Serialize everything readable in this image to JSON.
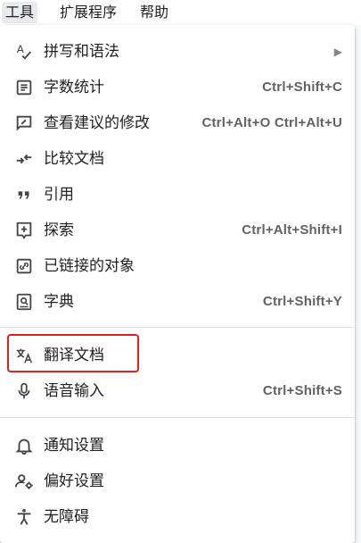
{
  "menubar": {
    "tools": "工具",
    "extensions": "扩展程序",
    "help": "帮助"
  },
  "menu": {
    "spelling": {
      "label": "拼写和语法",
      "icon": "spellcheck-icon"
    },
    "word_count": {
      "label": "字数统计",
      "shortcut": "Ctrl+Shift+C",
      "icon": "word-count-icon"
    },
    "review_edits": {
      "label": "查看建议的修改",
      "shortcut": "Ctrl+Alt+O Ctrl+Alt+U",
      "icon": "rate-review-icon"
    },
    "compare_docs": {
      "label": "比较文档",
      "icon": "compare-icon"
    },
    "citations": {
      "label": "引用",
      "icon": "quote-icon"
    },
    "explore": {
      "label": "探索",
      "shortcut": "Ctrl+Alt+Shift+I",
      "icon": "explore-icon"
    },
    "linked_objects": {
      "label": "已链接的对象",
      "icon": "linked-objects-icon"
    },
    "dictionary": {
      "label": "字典",
      "shortcut": "Ctrl+Shift+Y",
      "icon": "dictionary-icon"
    },
    "translate": {
      "label": "翻译文档",
      "icon": "translate-icon"
    },
    "voice_typing": {
      "label": "语音输入",
      "shortcut": "Ctrl+Shift+S",
      "icon": "microphone-icon"
    },
    "notifications": {
      "label": "通知设置",
      "icon": "bell-icon"
    },
    "preferences": {
      "label": "偏好设置",
      "icon": "person-settings-icon"
    },
    "accessibility": {
      "label": "无障碍",
      "icon": "accessibility-icon"
    }
  },
  "colors": {
    "highlight_border": "#e02020",
    "text": "#202124",
    "shortcut": "#5f6368"
  }
}
